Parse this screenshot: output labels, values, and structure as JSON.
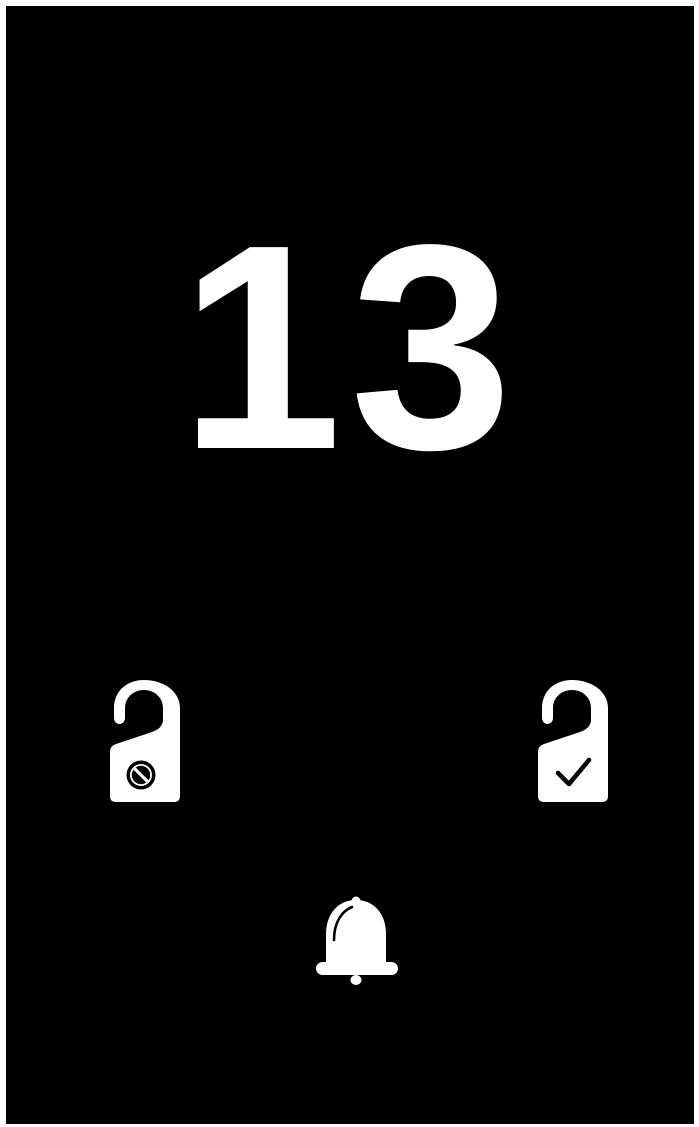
{
  "room": {
    "number": "13"
  },
  "controls": [
    {
      "id": "do-not-disturb",
      "icon": "door-hanger-prohibited-icon"
    },
    {
      "id": "make-up-room",
      "icon": "door-hanger-check-icon"
    },
    {
      "id": "call-service",
      "icon": "bell-icon"
    }
  ],
  "colors": {
    "background": "#000000",
    "foreground": "#ffffff",
    "frame": "#ffffff"
  }
}
